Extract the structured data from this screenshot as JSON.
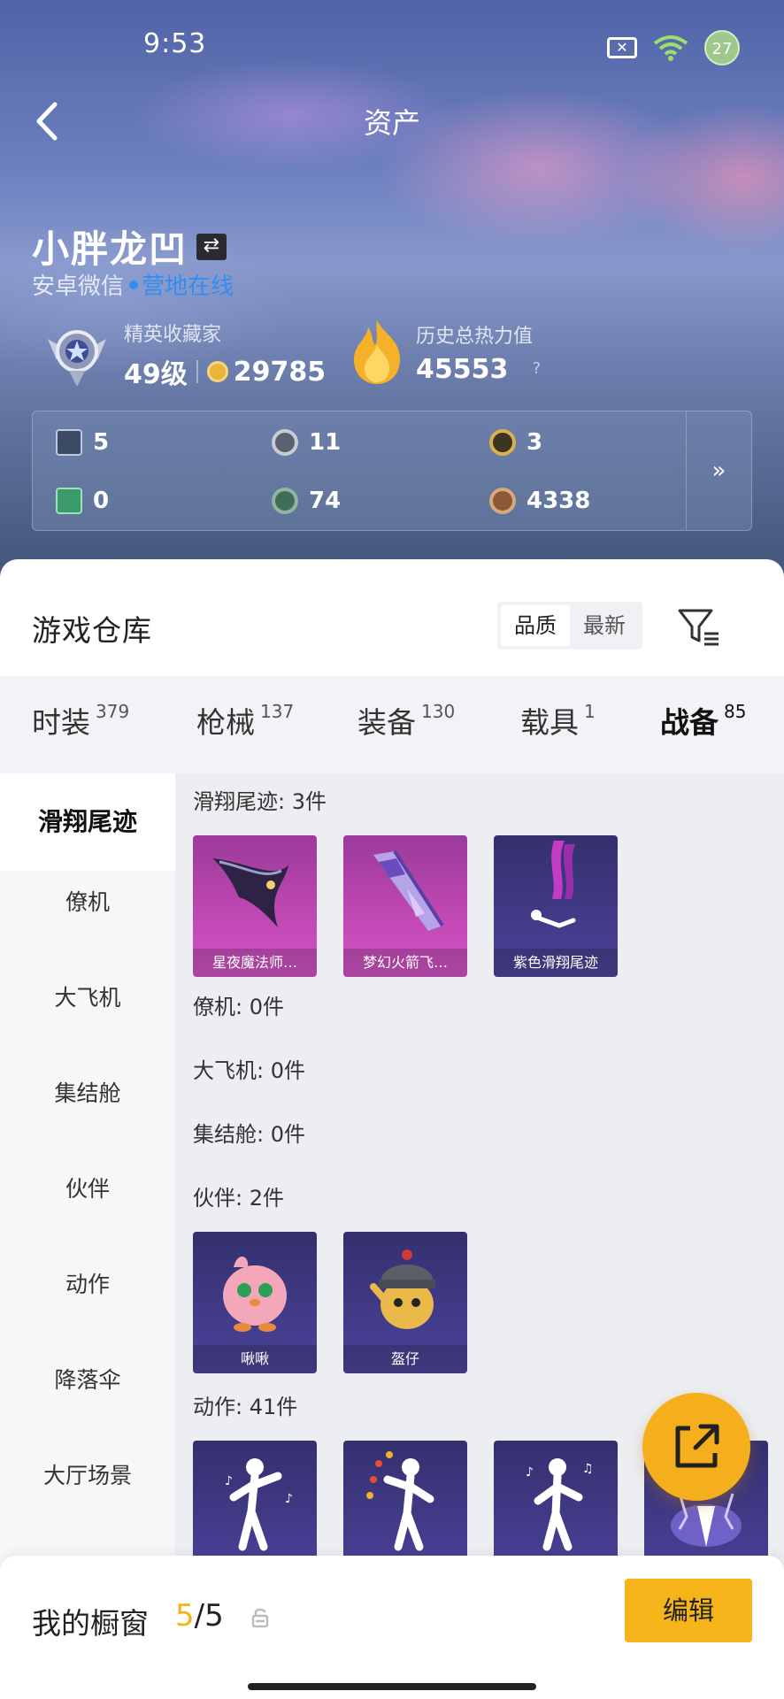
{
  "status_bar": {
    "time": "9:53",
    "battery": "27"
  },
  "header": {
    "title": "资产"
  },
  "profile": {
    "nickname": "小胖龙凹",
    "platform": "安卓微信",
    "online_status": "营地在线",
    "collector_title": "精英收藏家",
    "level": "49级",
    "coins": "29785",
    "heat_title": "历史总热力值",
    "heat_value": "45553",
    "help": "?"
  },
  "currencies": [
    {
      "value": "5",
      "icon": "card-icon",
      "color": "#3d4a66"
    },
    {
      "value": "11",
      "icon": "silver-coin-icon",
      "color": "#5b6170"
    },
    {
      "value": "3",
      "icon": "gold-token-icon",
      "color": "#3a3522"
    },
    {
      "value": "0",
      "icon": "green-ticket-icon",
      "color": "#3a9a6a"
    },
    {
      "value": "74",
      "icon": "green-orb-icon",
      "color": "#3f6d55"
    },
    {
      "value": "4338",
      "icon": "bronze-coin-icon",
      "color": "#8a5a36"
    }
  ],
  "currency_more": "»",
  "warehouse": {
    "title": "游戏仓库",
    "sort_options": [
      "品质",
      "最新"
    ],
    "tabs": [
      {
        "label": "时装",
        "count": "379"
      },
      {
        "label": "枪械",
        "count": "137"
      },
      {
        "label": "装备",
        "count": "130"
      },
      {
        "label": "载具",
        "count": "1"
      },
      {
        "label": "战备",
        "count": "85"
      }
    ],
    "side_nav": [
      "滑翔尾迹",
      "僚机",
      "大飞机",
      "集结舱",
      "伙伴",
      "动作",
      "降落伞",
      "大厅场景"
    ],
    "sections": {
      "trail": {
        "label": "滑翔尾迹: 3件",
        "items": [
          "星夜魔法师…",
          "梦幻火箭飞…",
          "紫色滑翔尾迹"
        ]
      },
      "wingman": {
        "label": "僚机: 0件"
      },
      "plane": {
        "label": "大飞机: 0件"
      },
      "capsule": {
        "label": "集结舱: 0件"
      },
      "partner": {
        "label": "伙伴: 2件",
        "items": [
          "啾啾",
          "盔仔"
        ]
      },
      "emote": {
        "label": "动作: 41件"
      }
    }
  },
  "showcase": {
    "label": "我的橱窗",
    "current": "5",
    "sep": "/",
    "total": "5",
    "edit_label": "编辑"
  },
  "colors": {
    "accent": "#f5b419",
    "online": "#2e8ff0"
  }
}
